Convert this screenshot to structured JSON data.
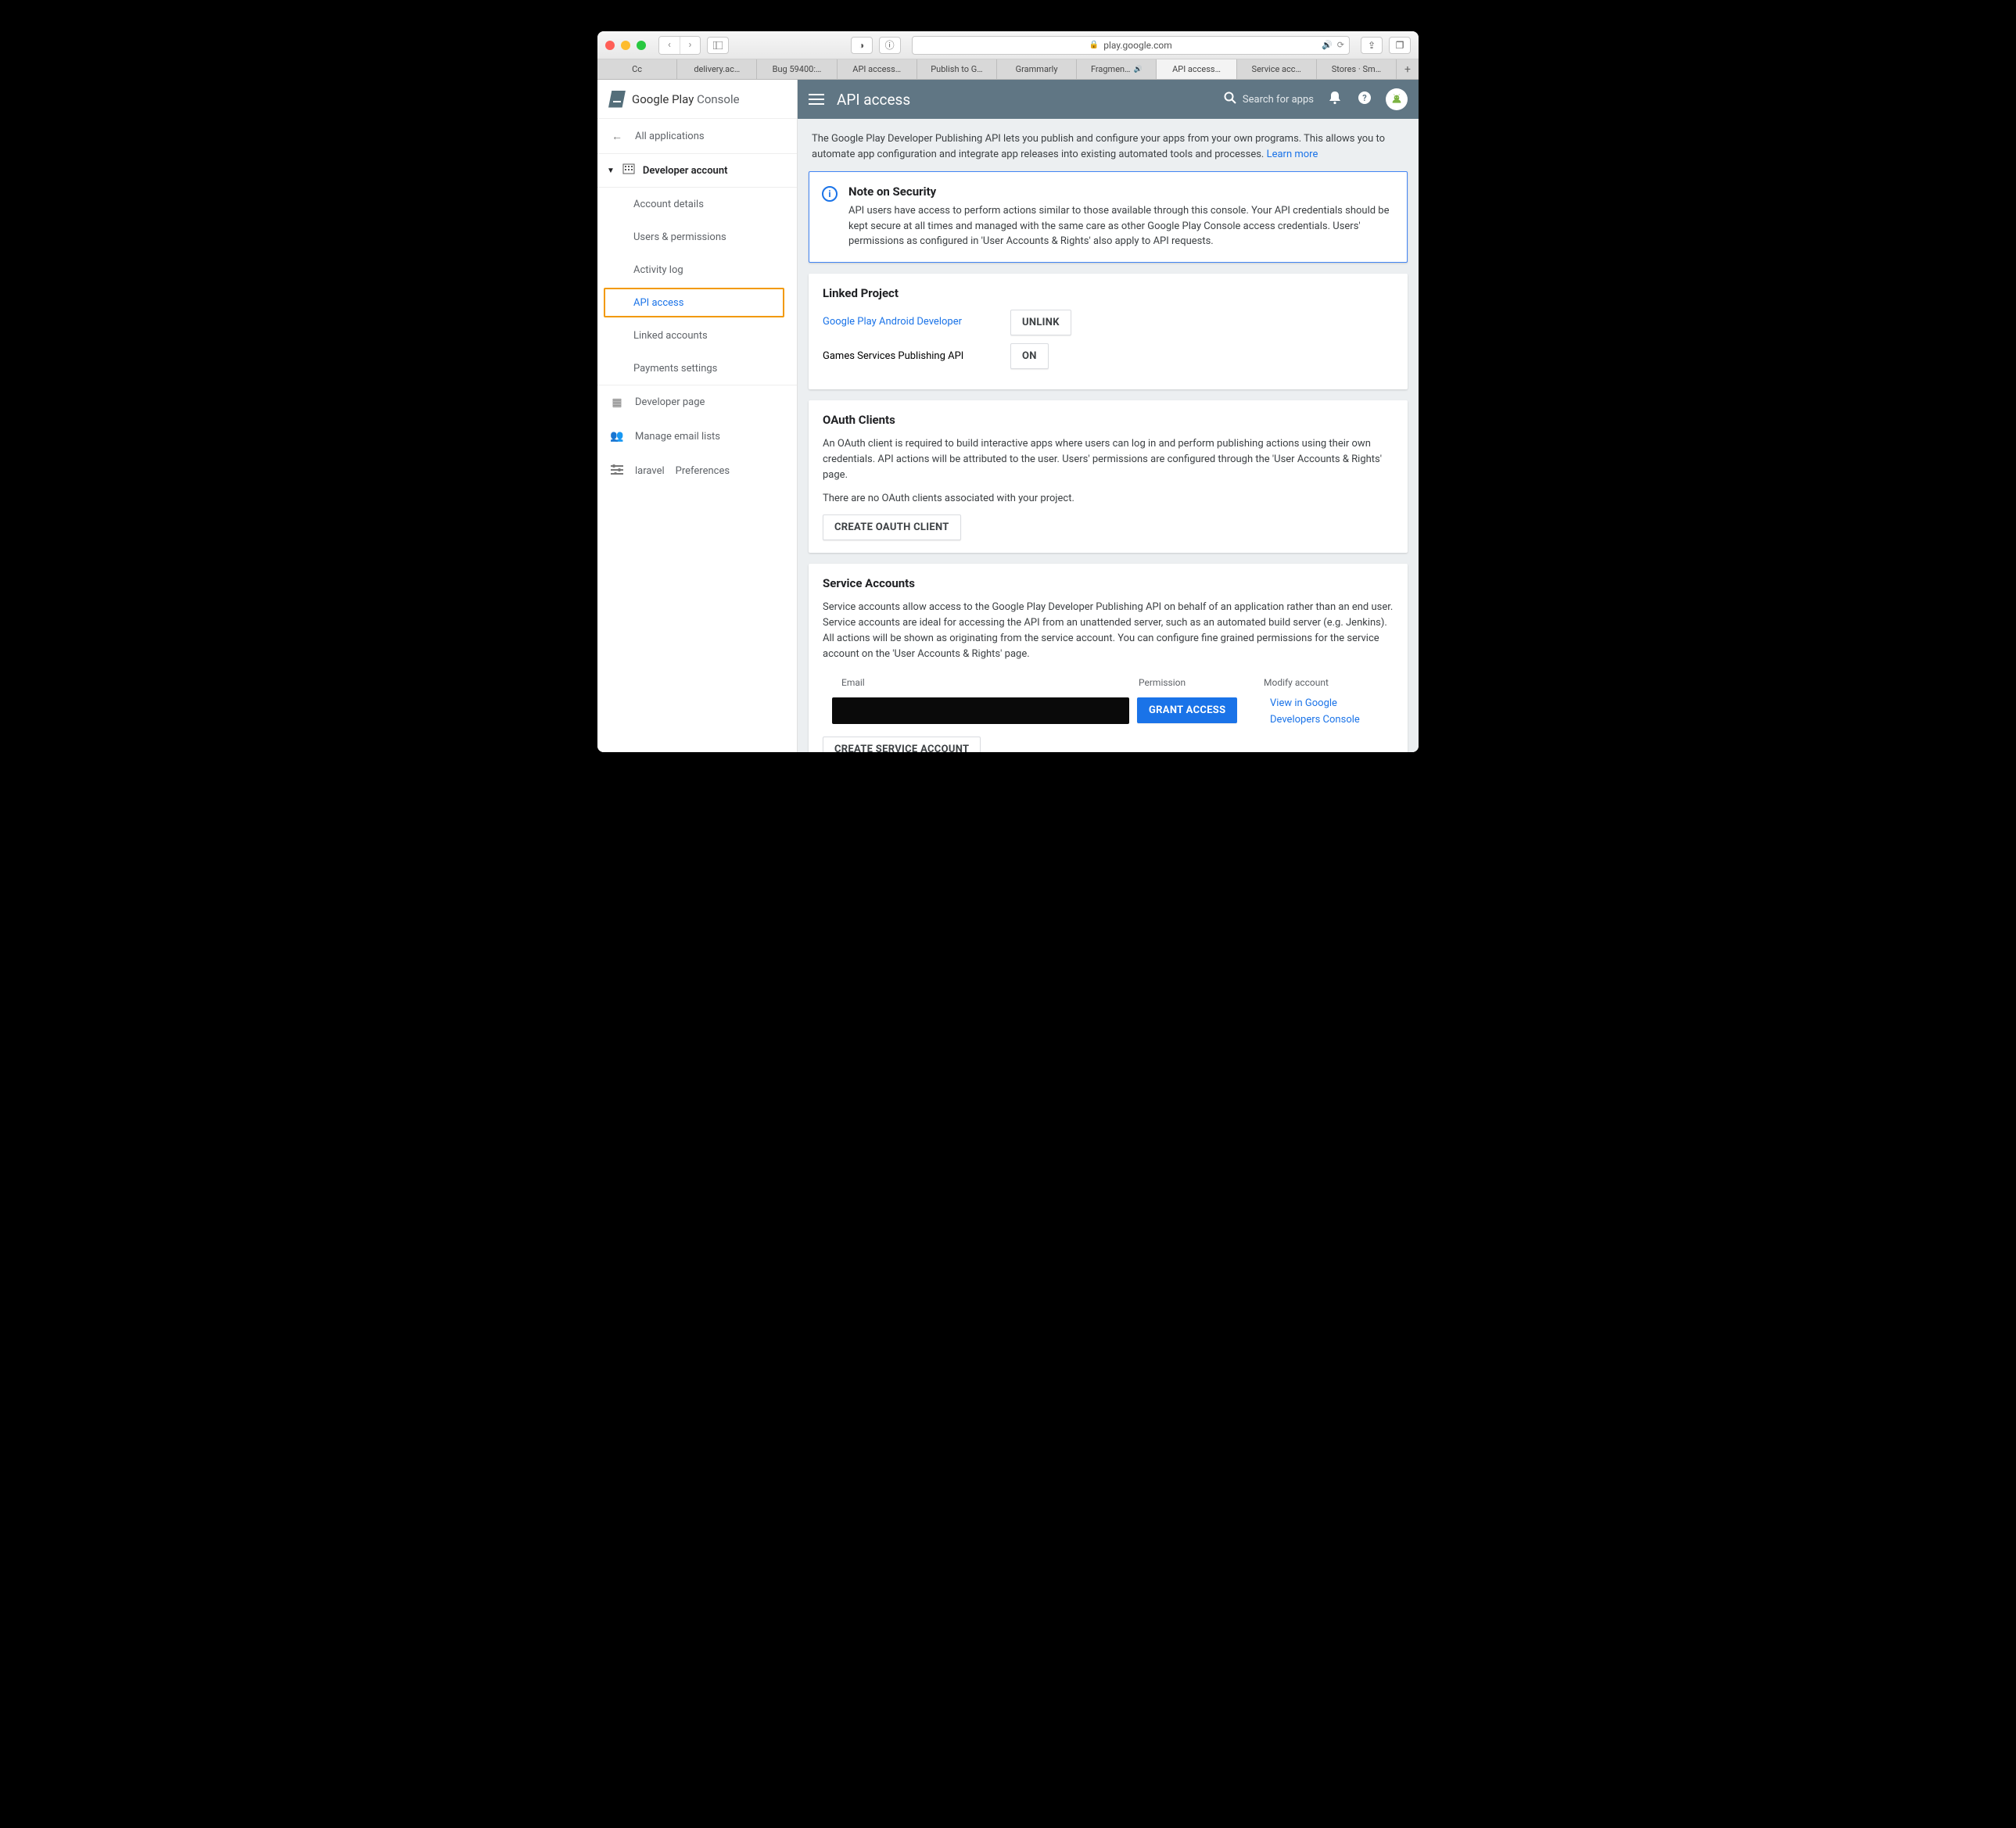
{
  "browser": {
    "url_host": "play.google.com",
    "tabs": [
      "Cc",
      "delivery.ac…",
      "Bug 59400:…",
      "API access…",
      "Publish to G…",
      "Grammarly",
      "Fragmen…",
      "API access…",
      "Service acc…",
      "Stores · Sm…"
    ],
    "active_tab_index": 7,
    "sound_tab_index": 6
  },
  "brand": {
    "name_a": "Google Play",
    "name_b": "Console"
  },
  "sidebar": {
    "all_apps": "All applications",
    "dev_account": "Developer account",
    "subs": [
      "Account details",
      "Users & permissions",
      "Activity log",
      "API access",
      "Linked accounts",
      "Payments settings"
    ],
    "dev_page": "Developer page",
    "manage_email": "Manage email lists",
    "preferences": "Preferences"
  },
  "topbar": {
    "title": "API access",
    "search_placeholder": "Search for apps"
  },
  "intro": {
    "text": "The Google Play Developer Publishing API lets you publish and configure your apps from your own programs. This allows you to automate app configuration and integrate app releases into existing automated tools and processes.",
    "learn_more": "Learn more"
  },
  "note": {
    "title": "Note on Security",
    "body": "API users have access to perform actions similar to those available through this console. Your API credentials should be kept secure at all times and managed with the same care as other Google Play Console access credentials. Users' permissions as configured in 'User Accounts & Rights' also apply to API requests."
  },
  "linked": {
    "title": "Linked Project",
    "row1_label": "Google Play Android Developer",
    "row1_btn": "UNLINK",
    "row2_label": "Games Services Publishing API",
    "row2_btn": "ON"
  },
  "oauth": {
    "title": "OAuth Clients",
    "desc": "An OAuth client is required to build interactive apps where users can log in and perform publishing actions using their own credentials. API actions will be attributed to the user. Users' permissions are configured through the 'User Accounts & Rights' page.",
    "empty": "There are no OAuth clients associated with your project.",
    "create_btn": "CREATE OAUTH CLIENT"
  },
  "svc": {
    "title": "Service Accounts",
    "desc": "Service accounts allow access to the Google Play Developer Publishing API on behalf of an application rather than an end user. Service accounts are ideal for accessing the API from an unattended server, such as an automated build server (e.g. Jenkins). All actions will be shown as originating from the service account. You can configure fine grained permissions for the service account on the 'User Accounts & Rights' page.",
    "col_email": "Email",
    "col_perm": "Permission",
    "col_modify": "Modify account",
    "grant_btn": "GRANT ACCESS",
    "view_link": "View in Google Developers Console",
    "create_btn": "CREATE SERVICE ACCOUNT"
  }
}
